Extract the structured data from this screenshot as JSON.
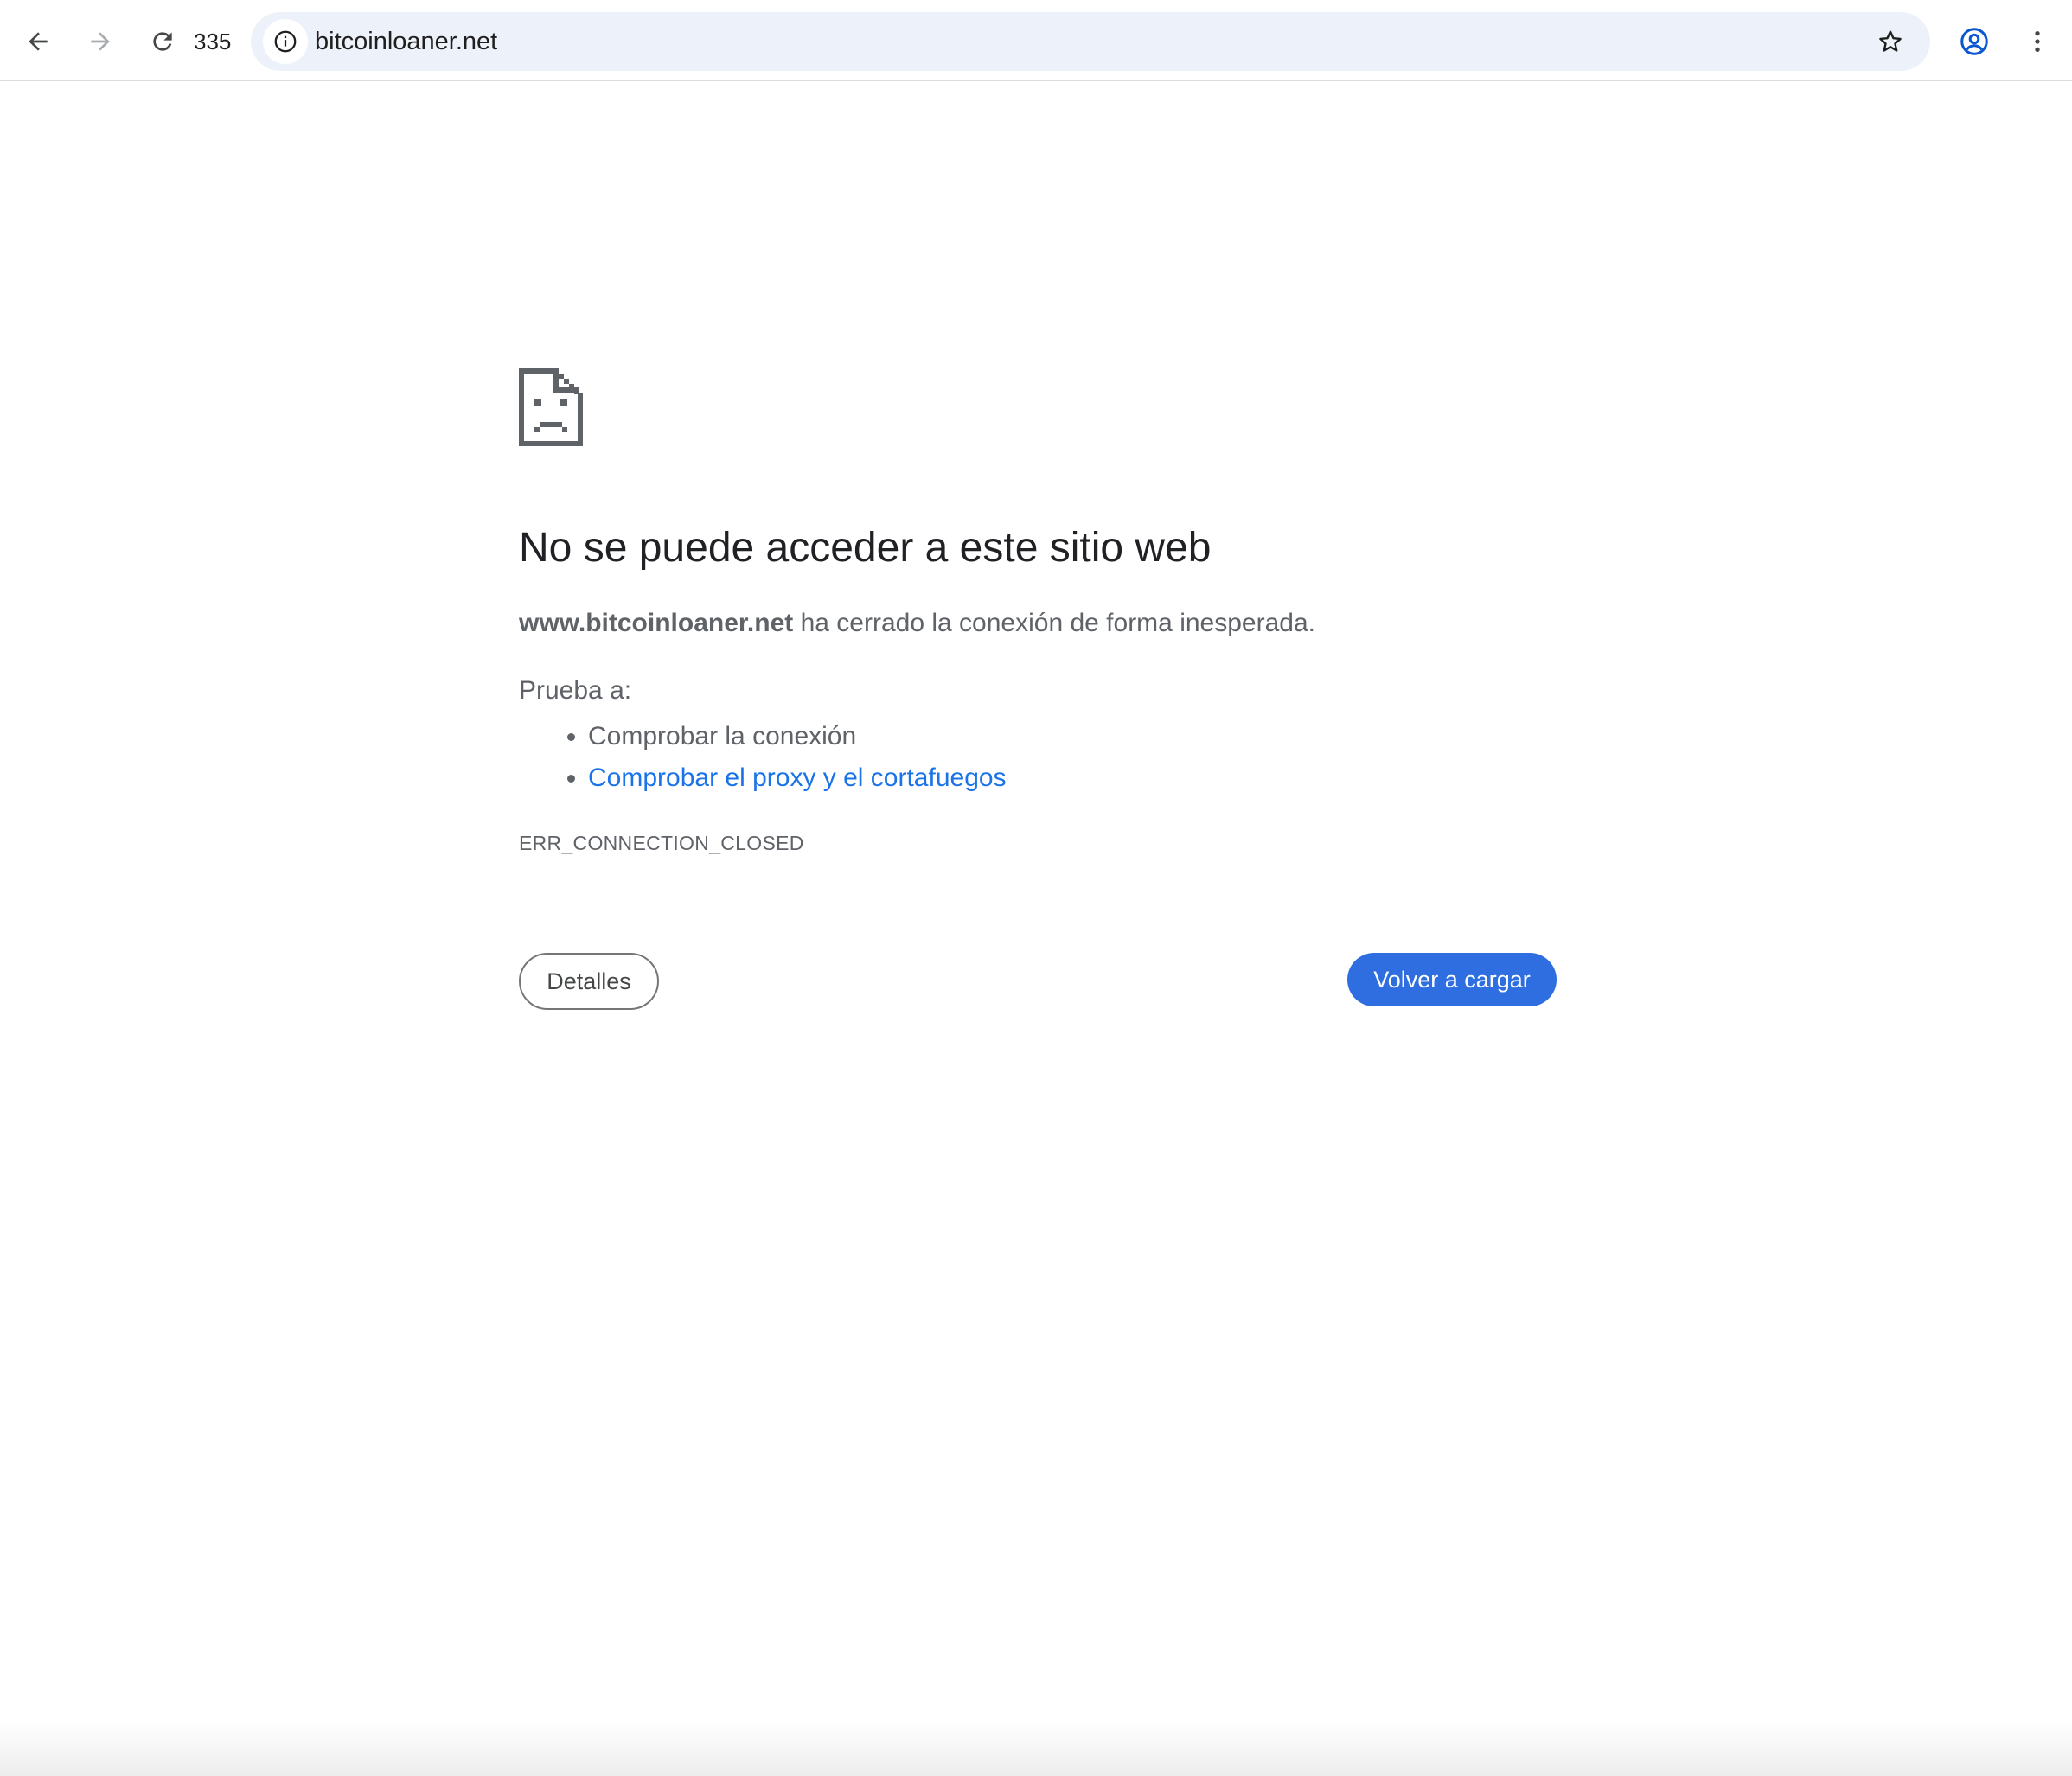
{
  "browser": {
    "reload_count": "335",
    "url": "bitcoinloaner.net",
    "icons": {
      "back": "arrow-left-icon",
      "forward": "arrow-right-icon",
      "reload": "reload-icon",
      "site_info": "info-icon",
      "bookmark": "star-icon",
      "profile": "account-circle-icon",
      "menu": "kebab-menu-icon"
    }
  },
  "error_page": {
    "icon": "sad-document-icon",
    "heading": "No se puede acceder a este sitio web",
    "host": "www.bitcoinloaner.net",
    "message": " ha cerrado la conexión de forma inesperada.",
    "try_label": "Prueba a:",
    "suggestions": [
      "Comprobar la conexión",
      "Comprobar el proxy y el cortafuegos"
    ],
    "error_code": "ERR_CONNECTION_CLOSED",
    "details_button": "Detalles",
    "reload_button": "Volver a cargar"
  },
  "colors": {
    "link": "#1a73e8",
    "primary_button": "#2e6ee0",
    "omnibox_bg": "#edf2fa",
    "text_secondary": "#5f6368"
  }
}
